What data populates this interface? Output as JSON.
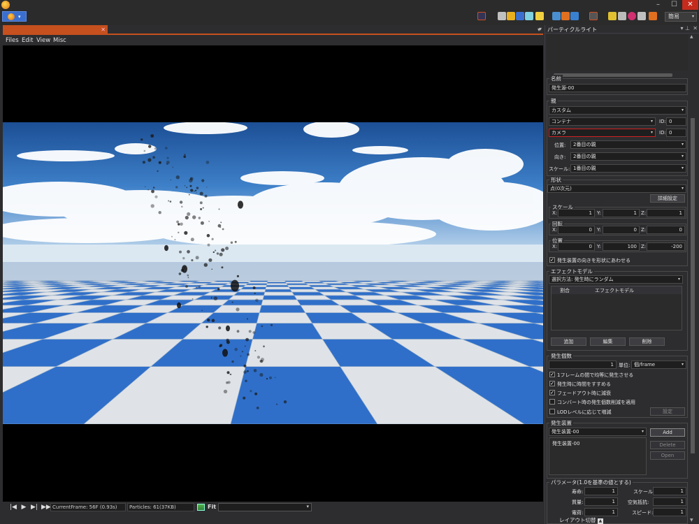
{
  "app": {
    "menu_caret": "▾",
    "icon": "app-logo-icon"
  },
  "window_buttons": {
    "minimize": "–",
    "maximize": "☐",
    "close": "✕"
  },
  "toolbar": {
    "mode_select": "簡易",
    "mode_caret": "▾"
  },
  "document_tab": {
    "close": "✕",
    "scroll_arrow": "▾"
  },
  "menu": [
    "Files",
    "Edit",
    "View",
    "Misc"
  ],
  "playback": {
    "buttons": [
      "|◀",
      "▶",
      "▶|",
      "▶▶"
    ],
    "current_frame": "CurrentFrame: 56F (0.93s)",
    "particles": "Particles: 61(37KB)",
    "fit_label": "Fit",
    "fit_caret": "▾"
  },
  "panel": {
    "title": "パーティクルライト",
    "arrow": "▾",
    "pin": "▾ ⊥",
    "close": "✕",
    "scroll_up": "▲",
    "scroll_down": "▼",
    "name": {
      "title": "名前",
      "value": "発生源-00"
    },
    "parent": {
      "title": "親",
      "type": "カスタム",
      "container": "コンテナ",
      "container_id_label": "ID:",
      "container_id": "0",
      "camera": "カメラ",
      "camera_id_label": "ID:",
      "camera_id": "0",
      "position_label": "位置:",
      "position_value": "2番目の親",
      "direction_label": "向き:",
      "direction_value": "2番目の親",
      "scale_label": "スケール:",
      "scale_value": "1番目の親"
    },
    "shape": {
      "title": "形状",
      "type": "点(0次元)",
      "details_button": "詳細設定",
      "scale": {
        "title": "スケール",
        "x_label": "X:",
        "x": "1",
        "y_label": "Y:",
        "y": "1",
        "z_label": "Z:",
        "z": "1"
      },
      "rotation": {
        "title": "回転",
        "x_label": "X:",
        "x": "0",
        "y_label": "Y:",
        "y": "0",
        "z_label": "Z:",
        "z": "0"
      },
      "position": {
        "title": "位置",
        "x_label": "X:",
        "x": "0",
        "y_label": "Y:",
        "y": "100",
        "z_label": "Z:",
        "z": "-200"
      },
      "align_checkbox": "発生装置の向きを形状にあわせる",
      "align_checked": "✓"
    },
    "effect_model": {
      "title": "エフェクトモデル",
      "selection": "選択方法: 発生時にランダム",
      "col_ratio": "割合",
      "col_model": "エフェクトモデル",
      "add_button": "追加",
      "edit_button": "編集",
      "delete_button": "削除"
    },
    "emit_count": {
      "title": "発生個数",
      "count": "1",
      "unit_label": "単位:",
      "unit_value": "個/frame",
      "options": [
        {
          "label": "1フレームの間で均等に発生させる",
          "mark": "✓"
        },
        {
          "label": "発生時に時間をすすめる",
          "mark": "✓"
        },
        {
          "label": "フェードアウト時に減衰",
          "mark": "✓"
        },
        {
          "label": "コンバート時の発生個数削減を適用",
          "mark": ""
        },
        {
          "label": "LODレベルに応じて増減",
          "mark": ""
        }
      ],
      "settings_button": "設定"
    },
    "emitter": {
      "title": "発生装置",
      "select": "発生装置-00",
      "list_item": "発生装置-00",
      "add_button": "Add",
      "delete_button": "Delete",
      "open_button": "Open"
    },
    "params": {
      "title": "パラメータ(1.0を基準の値とする)",
      "life_label": "寿命:",
      "life": "1",
      "mass_label": "質量:",
      "mass": "1",
      "charge_label": "電荷:",
      "charge": "1",
      "scale_label": "スケール:",
      "scale": "1",
      "drag_label": "空気抵抗:",
      "drag": "1",
      "speed_label": "スピード:",
      "speed": "1"
    },
    "layout_toggle": "レイアウト切替"
  },
  "colors": {
    "accent": "#c6501e",
    "sky": "#2f6fb8",
    "tile_blue": "#2f6fc9",
    "tile_white": "#dfe3e8",
    "highlight": "#d02020"
  }
}
